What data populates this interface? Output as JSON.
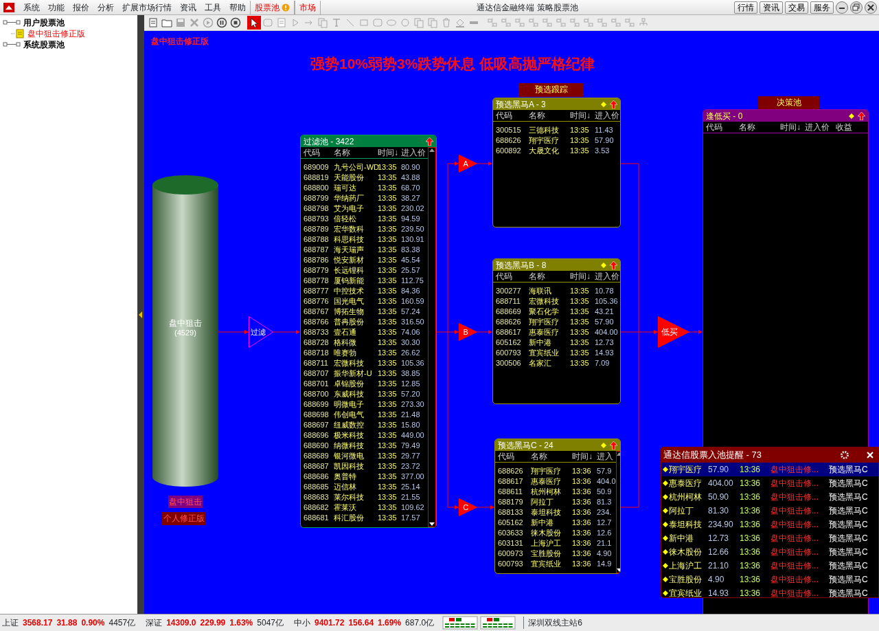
{
  "menu_bar": {
    "items": [
      {
        "label": "系统"
      },
      {
        "label": "功能"
      },
      {
        "label": "报价"
      },
      {
        "label": "分析"
      },
      {
        "label": "扩展市场行情"
      },
      {
        "label": "资讯"
      },
      {
        "label": "工具"
      },
      {
        "label": "帮助"
      }
    ],
    "tabs": [
      {
        "label": "股票池",
        "alert": true
      },
      {
        "label": "市场",
        "alert": false
      }
    ],
    "title": "通达信金融终端 策略股票池",
    "buttons": [
      {
        "label": "行情"
      },
      {
        "label": "资讯"
      },
      {
        "label": "交易"
      },
      {
        "label": "服务"
      }
    ]
  },
  "tree": [
    {
      "label": "用户股票池",
      "selected": false,
      "children": [
        {
          "label": "盘中狙击修正版",
          "selected": true
        }
      ]
    },
    {
      "label": "系统股票池",
      "selected": false
    }
  ],
  "toolbar": [
    {
      "kind": "doc",
      "selected": false,
      "disabled": false
    },
    {
      "kind": "folder",
      "selected": false,
      "disabled": false
    },
    {
      "kind": "save",
      "selected": false,
      "disabled": true
    },
    {
      "kind": "delete",
      "selected": false,
      "disabled": true
    },
    {
      "kind": "play",
      "selected": false,
      "disabled": true
    },
    {
      "kind": "pause",
      "selected": false,
      "disabled": false
    },
    {
      "kind": "stop",
      "selected": false,
      "disabled": false
    },
    {
      "kind": "pointer",
      "selected": true,
      "disabled": false
    },
    {
      "kind": "roundrect",
      "selected": false,
      "disabled": true
    },
    {
      "kind": "doc",
      "selected": false,
      "disabled": true
    },
    {
      "kind": "triangle",
      "selected": false,
      "disabled": true
    },
    {
      "kind": "arrow",
      "selected": false,
      "disabled": true
    },
    {
      "kind": "copy",
      "selected": false,
      "disabled": true
    },
    {
      "kind": "text",
      "selected": false,
      "disabled": true
    },
    {
      "kind": "line",
      "selected": false,
      "disabled": true
    },
    {
      "kind": "rect",
      "selected": false,
      "disabled": true
    },
    {
      "kind": "roundrect",
      "selected": false,
      "disabled": true
    },
    {
      "kind": "ellipse",
      "selected": false,
      "disabled": true
    },
    {
      "kind": "circle",
      "selected": false,
      "disabled": true
    },
    {
      "kind": "copy",
      "selected": false,
      "disabled": true
    },
    {
      "kind": "copy",
      "selected": false,
      "disabled": true
    },
    {
      "kind": "trash",
      "selected": false,
      "disabled": true
    },
    {
      "kind": "bucket",
      "selected": false,
      "disabled": true
    },
    {
      "kind": "bar",
      "selected": false,
      "disabled": true
    },
    {
      "kind": "align",
      "selected": false,
      "disabled": true
    },
    {
      "kind": "align",
      "selected": false,
      "disabled": true
    },
    {
      "kind": "align",
      "selected": false,
      "disabled": true
    },
    {
      "kind": "align",
      "selected": false,
      "disabled": true
    },
    {
      "kind": "align",
      "selected": false,
      "disabled": true
    },
    {
      "kind": "align",
      "selected": false,
      "disabled": true
    },
    {
      "kind": "align",
      "selected": false,
      "disabled": true
    },
    {
      "kind": "align",
      "selected": false,
      "disabled": true
    },
    {
      "kind": "align",
      "selected": false,
      "disabled": true
    },
    {
      "kind": "align",
      "selected": false,
      "disabled": true
    },
    {
      "kind": "align",
      "selected": false,
      "disabled": true
    },
    {
      "kind": "network",
      "selected": false,
      "disabled": true
    }
  ],
  "canvas": {
    "strategy_name": "盘中狙击修正版",
    "headline": "强势10%弱势3%跌势休息 低吸高抛严格纪律",
    "source": {
      "name": "盘中狙击",
      "count": "(4529)",
      "tag": "盘中狙击",
      "subtag": "个人修正版"
    },
    "filter_node": "过滤",
    "branch_nodes": [
      "A",
      "B",
      "C"
    ],
    "buy_node": "低买",
    "tracking_label": "预选跟踪",
    "decision_label": "决策池",
    "pools": [
      {
        "kind": "filter",
        "title": "过滤池 - 3422",
        "scrollbar": true,
        "columns": [
          "代码",
          "名称",
          "时间↓",
          "进入价"
        ],
        "rows": [
          [
            "689009",
            "九号公司-WD",
            "13:35",
            "80.90"
          ],
          [
            "688819",
            "天能股份",
            "13:35",
            "43.88"
          ],
          [
            "688800",
            "瑞可达",
            "13:35",
            "68.70"
          ],
          [
            "688799",
            "华纳药厂",
            "13:35",
            "38.27"
          ],
          [
            "688798",
            "艾为电子",
            "13:35",
            "230.02"
          ],
          [
            "688793",
            "倍轻松",
            "13:35",
            "94.59"
          ],
          [
            "688789",
            "宏华数科",
            "13:35",
            "239.50"
          ],
          [
            "688788",
            "科思科技",
            "13:35",
            "130.91"
          ],
          [
            "688787",
            "海天瑞声",
            "13:35",
            "83.38"
          ],
          [
            "688786",
            "悦安新材",
            "13:35",
            "45.54"
          ],
          [
            "688779",
            "长远锂科",
            "13:35",
            "25.57"
          ],
          [
            "688778",
            "厦钨新能",
            "13:35",
            "112.75"
          ],
          [
            "688777",
            "中控技术",
            "13:35",
            "84.36"
          ],
          [
            "688776",
            "国光电气",
            "13:35",
            "160.59"
          ],
          [
            "688767",
            "博拓生物",
            "13:35",
            "57.24"
          ],
          [
            "688766",
            "普冉股份",
            "13:35",
            "316.50"
          ],
          [
            "688733",
            "壹石通",
            "13:35",
            "74.06"
          ],
          [
            "688728",
            "格科微",
            "13:35",
            "30.30"
          ],
          [
            "688718",
            "唯赛勃",
            "13:35",
            "26.62"
          ],
          [
            "688711",
            "宏微科技",
            "13:35",
            "105.36"
          ],
          [
            "688707",
            "振华新材-U",
            "13:35",
            "38.85"
          ],
          [
            "688701",
            "卓锦股份",
            "13:35",
            "12.85"
          ],
          [
            "688700",
            "东威科技",
            "13:35",
            "57.20"
          ],
          [
            "688699",
            "明微电子",
            "13:35",
            "273.30"
          ],
          [
            "688698",
            "伟创电气",
            "13:35",
            "21.48"
          ],
          [
            "688697",
            "纽威数控",
            "13:35",
            "15.80"
          ],
          [
            "688696",
            "极米科技",
            "13:35",
            "449.00"
          ],
          [
            "688690",
            "纳微科技",
            "13:35",
            "79.49"
          ],
          [
            "688689",
            "银河微电",
            "13:35",
            "29.77"
          ],
          [
            "688687",
            "凯因科技",
            "13:35",
            "23.72"
          ],
          [
            "688686",
            "奥普特",
            "13:35",
            "377.00"
          ],
          [
            "688685",
            "迈信林",
            "13:35",
            "25.14"
          ],
          [
            "688683",
            "莱尔科技",
            "13:35",
            "21.55"
          ],
          [
            "688682",
            "霍莱沃",
            "13:35",
            "109.62"
          ],
          [
            "688681",
            "科汇股份",
            "13:35",
            "17.57"
          ]
        ]
      },
      {
        "kind": "track",
        "title": "预选黑马A - 3",
        "scrollbar": false,
        "columns": [
          "代码",
          "名称",
          "时间↓",
          "进入价"
        ],
        "rows": [
          [
            "300515",
            "三德科技",
            "13:35",
            "11.43"
          ],
          [
            "688626",
            "翔宇医疗",
            "13:35",
            "57.90"
          ],
          [
            "600892",
            "大晟文化",
            "13:35",
            "3.53"
          ]
        ]
      },
      {
        "kind": "track",
        "title": "预选黑马B - 8",
        "scrollbar": false,
        "columns": [
          "代码",
          "名称",
          "时间↓",
          "进入价"
        ],
        "rows": [
          [
            "300277",
            "海联讯",
            "13:35",
            "10.78"
          ],
          [
            "688711",
            "宏微科技",
            "13:35",
            "105.36"
          ],
          [
            "688669",
            "聚石化学",
            "13:35",
            "43.21"
          ],
          [
            "688626",
            "翔宇医疗",
            "13:35",
            "57.90"
          ],
          [
            "688617",
            "惠泰医疗",
            "13:35",
            "404.00"
          ],
          [
            "605162",
            "新中港",
            "13:35",
            "12.73"
          ],
          [
            "600793",
            "宜宾纸业",
            "13:35",
            "14.93"
          ],
          [
            "300506",
            "名家汇",
            "13:35",
            "7.09"
          ]
        ]
      },
      {
        "kind": "track",
        "title": "预选黑马C - 24",
        "scrollbar": true,
        "columns": [
          "代码",
          "名称",
          "时间↓",
          "进入"
        ],
        "rows": [
          [
            "688626",
            "翔宇医疗",
            "13:36",
            "57.9"
          ],
          [
            "688617",
            "惠泰医疗",
            "13:36",
            "404.0"
          ],
          [
            "688611",
            "杭州柯林",
            "13:36",
            "50.9"
          ],
          [
            "688179",
            "阿拉丁",
            "13:36",
            "81.3"
          ],
          [
            "688133",
            "泰坦科技",
            "13:36",
            "234."
          ],
          [
            "605162",
            "新中港",
            "13:36",
            "12.7"
          ],
          [
            "603633",
            "徕木股份",
            "13:36",
            "12.6"
          ],
          [
            "603131",
            "上海沪工",
            "13:36",
            "21.1"
          ],
          [
            "600973",
            "宝胜股份",
            "13:36",
            "4.90"
          ],
          [
            "600793",
            "宜宾纸业",
            "13:36",
            "14.9"
          ]
        ]
      },
      {
        "kind": "decision",
        "title": "逢低买 - 0",
        "scrollbar": false,
        "columns": [
          "代码",
          "名称",
          "时间↓",
          "进入价",
          "收益"
        ]
      }
    ],
    "popup": {
      "title": "通达信股票入池提醒 - 73",
      "rows": [
        {
          "name": "翔宇医疗",
          "price": "57.90",
          "time": "13:36",
          "strategy": "盘中狙击修...",
          "pool": "预选黑马C",
          "selected": true
        },
        {
          "name": "惠泰医疗",
          "price": "404.00",
          "time": "13:36",
          "strategy": "盘中狙击修...",
          "pool": "预选黑马C",
          "selected": false
        },
        {
          "name": "杭州柯林",
          "price": "50.90",
          "time": "13:36",
          "strategy": "盘中狙击修...",
          "pool": "预选黑马C",
          "selected": false
        },
        {
          "name": "阿拉丁",
          "price": "81.30",
          "time": "13:36",
          "strategy": "盘中狙击修...",
          "pool": "预选黑马C",
          "selected": false
        },
        {
          "name": "泰坦科技",
          "price": "234.90",
          "time": "13:36",
          "strategy": "盘中狙击修...",
          "pool": "预选黑马C",
          "selected": false
        },
        {
          "name": "新中港",
          "price": "12.73",
          "time": "13:36",
          "strategy": "盘中狙击修...",
          "pool": "预选黑马C",
          "selected": false
        },
        {
          "name": "徕木股份",
          "price": "12.66",
          "time": "13:36",
          "strategy": "盘中狙击修...",
          "pool": "预选黑马C",
          "selected": false
        },
        {
          "name": "上海沪工",
          "price": "21.10",
          "time": "13:36",
          "strategy": "盘中狙击修...",
          "pool": "预选黑马C",
          "selected": false
        },
        {
          "name": "宝胜股份",
          "price": "4.90",
          "time": "13:36",
          "strategy": "盘中狙击修...",
          "pool": "预选黑马C",
          "selected": false
        },
        {
          "name": "宜宾纸业",
          "price": "14.93",
          "time": "13:36",
          "strategy": "盘中狙击修...",
          "pool": "预选黑马C",
          "selected": false
        }
      ]
    }
  },
  "status_bar": {
    "indices": [
      {
        "name": "上证",
        "value": "3568.17",
        "change": "31.88",
        "percent": "0.90%",
        "volume": "4457亿"
      },
      {
        "name": "深证",
        "value": "14309.0",
        "change": "229.99",
        "percent": "1.63%",
        "volume": "5047亿"
      },
      {
        "name": "中小",
        "value": "9401.72",
        "change": "156.64",
        "percent": "1.69%",
        "volume": "687.0亿"
      }
    ],
    "server": "深圳双线主站6"
  }
}
